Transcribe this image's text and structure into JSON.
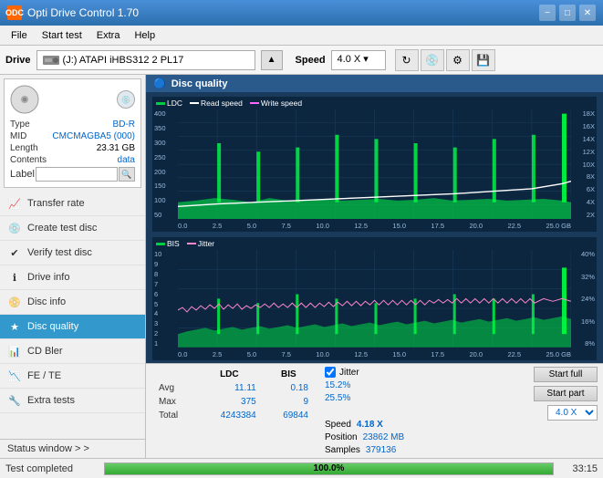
{
  "app": {
    "title": "Opti Drive Control 1.70",
    "icon": "ODC"
  },
  "titlebar": {
    "minimize_label": "−",
    "maximize_label": "□",
    "close_label": "✕"
  },
  "menu": {
    "items": [
      "File",
      "Start test",
      "Extra",
      "Help"
    ]
  },
  "drive_bar": {
    "label": "Drive",
    "drive_value": "(J:)  ATAPI iHBS312  2 PL17",
    "speed_label": "Speed",
    "speed_value": "4.0 X"
  },
  "disc_info": {
    "type_label": "Type",
    "type_value": "BD-R",
    "mid_label": "MID",
    "mid_value": "CMCMAGBA5 (000)",
    "length_label": "Length",
    "length_value": "23.31 GB",
    "contents_label": "Contents",
    "contents_value": "data",
    "label_label": "Label",
    "label_value": ""
  },
  "nav": {
    "items": [
      {
        "id": "transfer-rate",
        "label": "Transfer rate",
        "icon": "📈"
      },
      {
        "id": "create-test-disc",
        "label": "Create test disc",
        "icon": "💿"
      },
      {
        "id": "verify-test-disc",
        "label": "Verify test disc",
        "icon": "✔"
      },
      {
        "id": "drive-info",
        "label": "Drive info",
        "icon": "ℹ"
      },
      {
        "id": "disc-info",
        "label": "Disc info",
        "icon": "📀"
      },
      {
        "id": "disc-quality",
        "label": "Disc quality",
        "icon": "★",
        "active": true
      },
      {
        "id": "cd-bler",
        "label": "CD Bler",
        "icon": "📊"
      },
      {
        "id": "fe-te",
        "label": "FE / TE",
        "icon": "📉"
      },
      {
        "id": "extra-tests",
        "label": "Extra tests",
        "icon": "🔧"
      }
    ]
  },
  "status_window": {
    "label": "Status window > >"
  },
  "disc_quality": {
    "title": "Disc quality",
    "legend_top": {
      "ldc": "LDC",
      "read_speed": "Read speed",
      "write_speed": "Write speed"
    },
    "legend_bottom": {
      "bis": "BIS",
      "jitter": "Jitter"
    },
    "x_labels": [
      "0.0",
      "2.5",
      "5.0",
      "7.5",
      "10.0",
      "12.5",
      "15.0",
      "17.5",
      "20.0",
      "22.5",
      "25.0 GB"
    ],
    "y_top_left": [
      "400",
      "350",
      "300",
      "250",
      "200",
      "150",
      "100",
      "50"
    ],
    "y_top_right": [
      "18X",
      "16X",
      "14X",
      "12X",
      "10X",
      "8X",
      "6X",
      "4X",
      "2X"
    ],
    "y_bottom_left": [
      "10",
      "9",
      "8",
      "7",
      "6",
      "5",
      "4",
      "3",
      "2",
      "1"
    ],
    "y_bottom_right": [
      "40%",
      "32%",
      "24%",
      "16%",
      "8%"
    ]
  },
  "stats": {
    "headers": [
      "LDC",
      "BIS"
    ],
    "jitter_label": "Jitter",
    "jitter_checked": true,
    "avg_label": "Avg",
    "avg_ldc": "11.11",
    "avg_bis": "0.18",
    "avg_jitter": "15.2%",
    "max_label": "Max",
    "max_ldc": "375",
    "max_bis": "9",
    "max_jitter": "25.5%",
    "total_label": "Total",
    "total_ldc": "4243384",
    "total_bis": "69844",
    "speed_label": "Speed",
    "speed_value": "4.18 X",
    "speed_dropdown": "4.0 X",
    "position_label": "Position",
    "position_value": "23862 MB",
    "samples_label": "Samples",
    "samples_value": "379136",
    "start_full_label": "Start full",
    "start_part_label": "Start part"
  },
  "statusbar": {
    "text": "Test completed",
    "progress": "100.0%",
    "progress_value": 100,
    "time": "33:15"
  },
  "colors": {
    "ldc_color": "#00cc44",
    "bis_color": "#00cc44",
    "jitter_color": "#ff88cc",
    "read_speed_color": "#ffffff",
    "write_speed_color": "#ff66ff",
    "accent_blue": "#0066cc",
    "chart_bg": "#0a1f35",
    "grid_color": "#1a3a5a",
    "spike_color": "#00ff44"
  }
}
